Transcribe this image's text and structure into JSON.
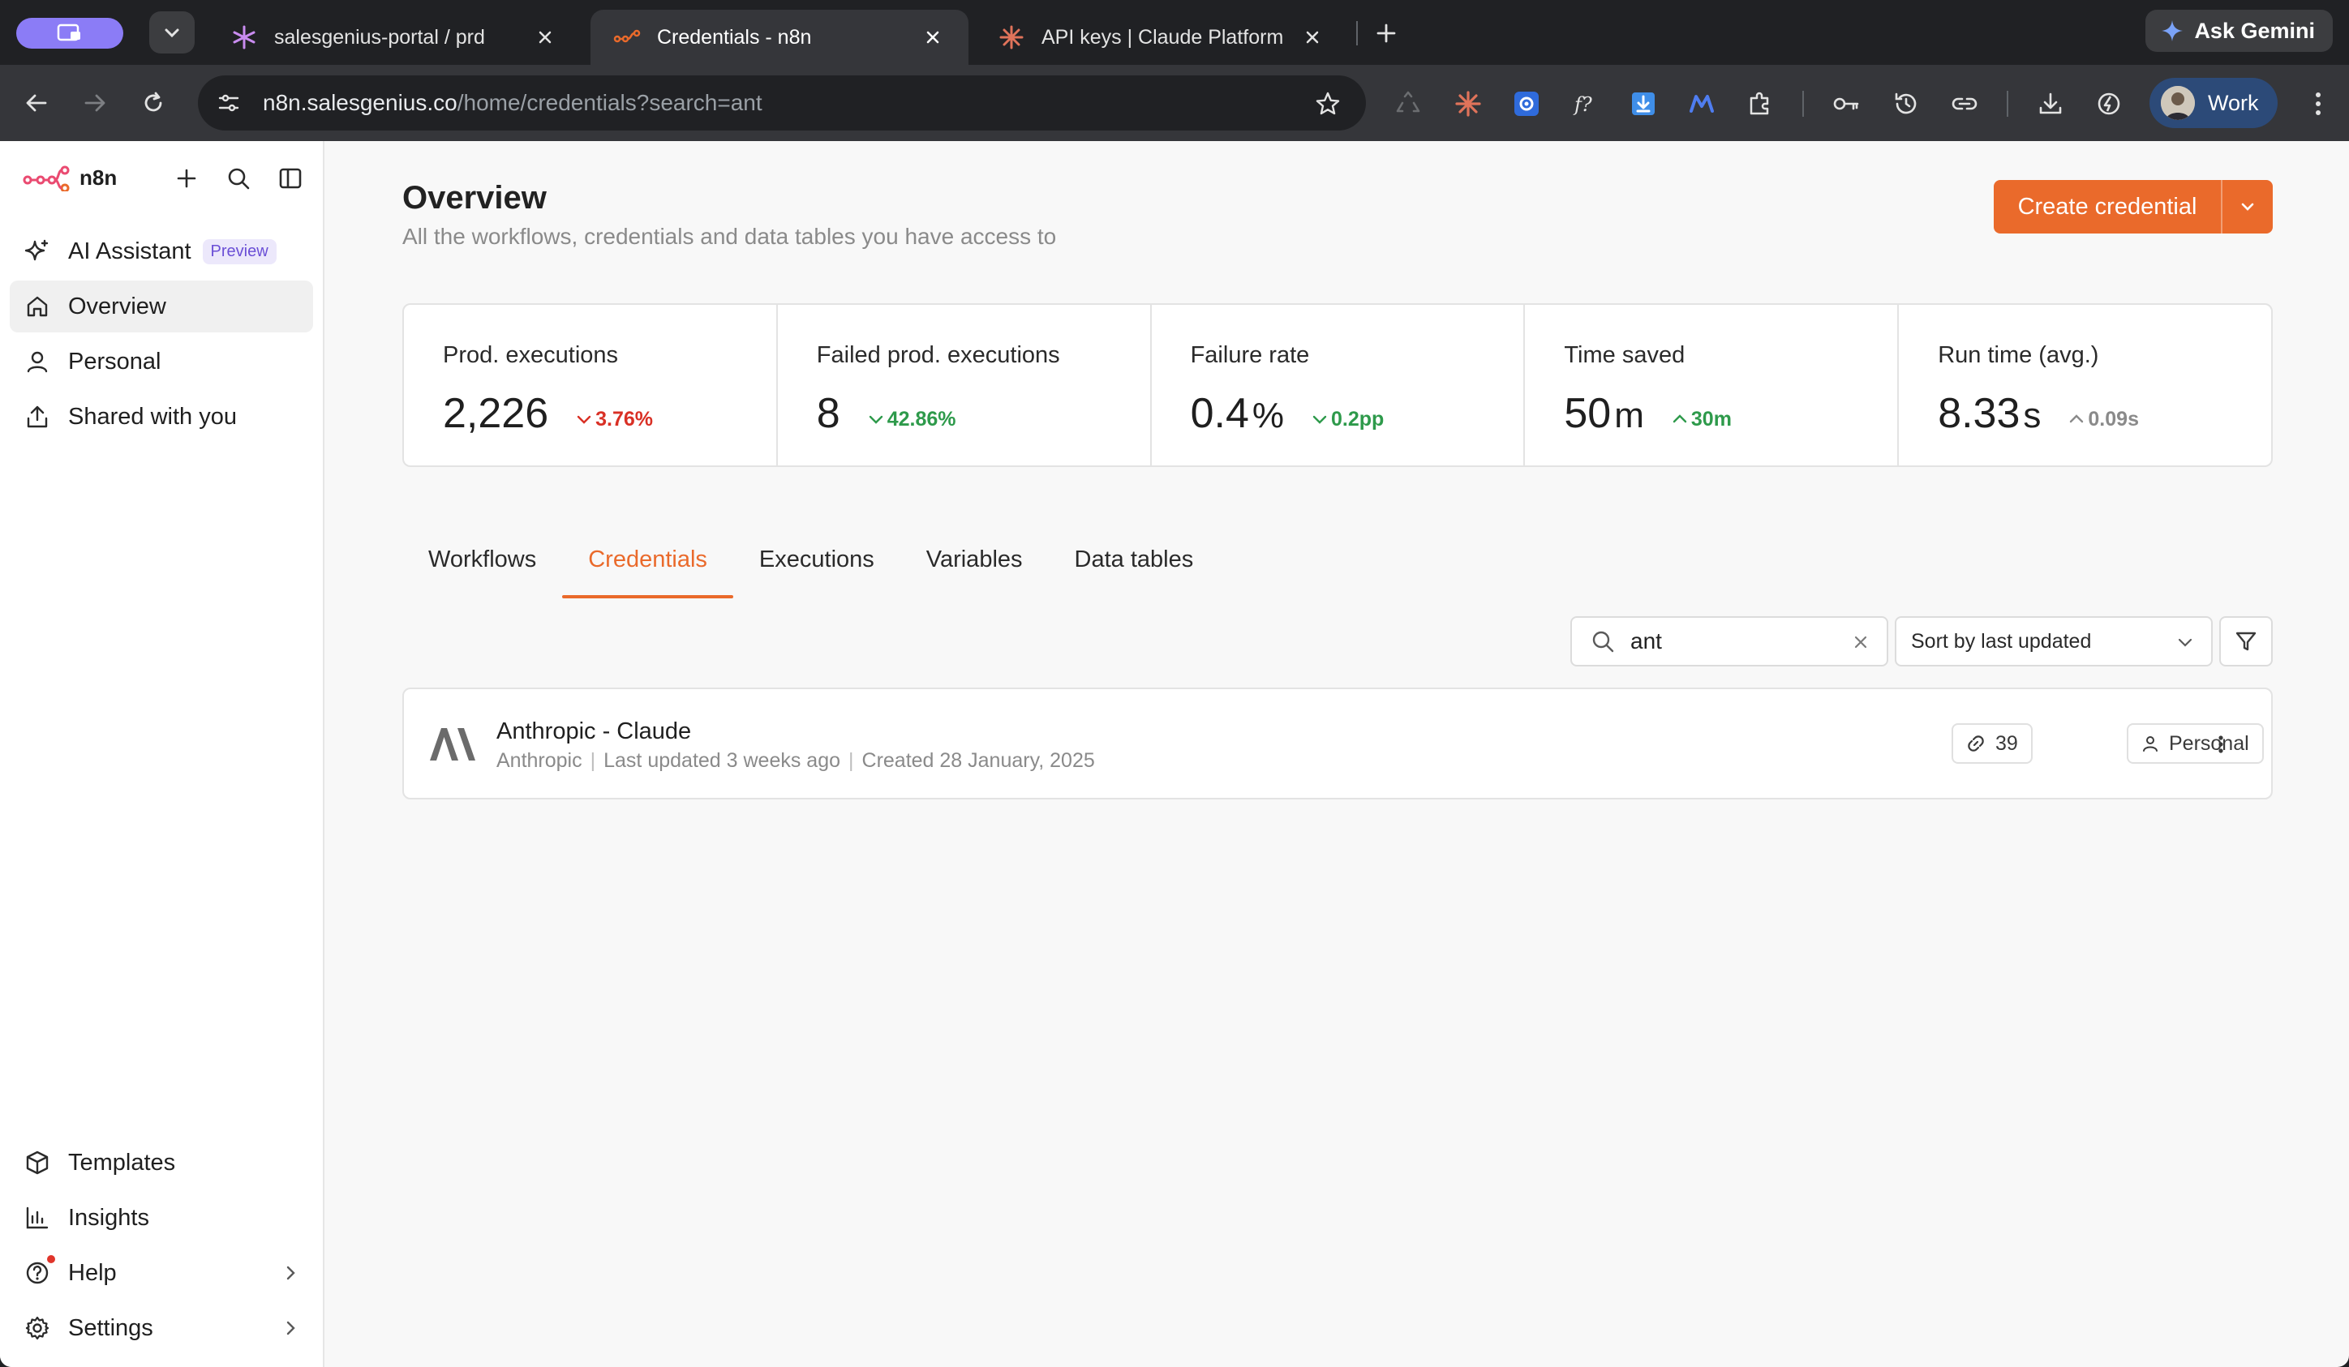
{
  "browser": {
    "tabs": [
      {
        "title": "salesgenius-portal / prd",
        "favicon": "salesgenius-icon"
      },
      {
        "title": "Credentials - n8n",
        "favicon": "n8n-icon",
        "active": true
      },
      {
        "title": "API keys | Claude Platform",
        "favicon": "claude-icon"
      }
    ],
    "ask_gemini_label": "Ask Gemini",
    "url_host": "n8n.salesgenius.co",
    "url_path": "/home/credentials?search=ant",
    "profile_label": "Work"
  },
  "sidebar": {
    "brand": "n8n",
    "nav": [
      {
        "label": "AI Assistant",
        "badge": "Preview",
        "icon": "sparkle-icon"
      },
      {
        "label": "Overview",
        "icon": "home-icon",
        "active": true
      },
      {
        "label": "Personal",
        "icon": "user-icon"
      },
      {
        "label": "Shared with you",
        "icon": "share-icon"
      }
    ],
    "bottom": [
      {
        "label": "Templates",
        "icon": "box-icon"
      },
      {
        "label": "Insights",
        "icon": "chart-icon"
      },
      {
        "label": "Help",
        "icon": "help-icon"
      },
      {
        "label": "Settings",
        "icon": "gear-icon"
      }
    ]
  },
  "main": {
    "title": "Overview",
    "subtitle": "All the workflows, credentials and data tables you have access to",
    "create_button": "Create credential",
    "stats": [
      {
        "label": "Prod. executions",
        "value": "2,226",
        "unit": "",
        "delta": "3.76%",
        "direction": "down",
        "color": "#d93025"
      },
      {
        "label": "Failed prod. executions",
        "value": "8",
        "unit": "",
        "delta": "42.86%",
        "direction": "down",
        "color": "#2e9a4b"
      },
      {
        "label": "Failure rate",
        "value": "0.4",
        "unit": "%",
        "delta": "0.2pp",
        "direction": "down",
        "color": "#2e9a4b"
      },
      {
        "label": "Time saved",
        "value": "50",
        "unit": "m",
        "delta": "30m",
        "direction": "up",
        "color": "#2e9a4b"
      },
      {
        "label": "Run time (avg.)",
        "value": "8.33",
        "unit": "s",
        "delta": "0.09s",
        "direction": "up",
        "color": "#8a8a8a"
      }
    ],
    "tabs": [
      "Workflows",
      "Credentials",
      "Executions",
      "Variables",
      "Data tables"
    ],
    "active_tab": "Credentials",
    "search_value": "ant",
    "sort_label": "Sort by last updated",
    "credentials": [
      {
        "name": "Anthropic - Claude",
        "type": "Anthropic",
        "last_updated": "Last updated 3 weeks ago",
        "created": "Created 28 January, 2025",
        "usage_count": "39",
        "owner": "Personal"
      }
    ]
  },
  "colors": {
    "accent": "#ea6a2b",
    "positive": "#2e9a4b",
    "negative": "#d93025"
  }
}
